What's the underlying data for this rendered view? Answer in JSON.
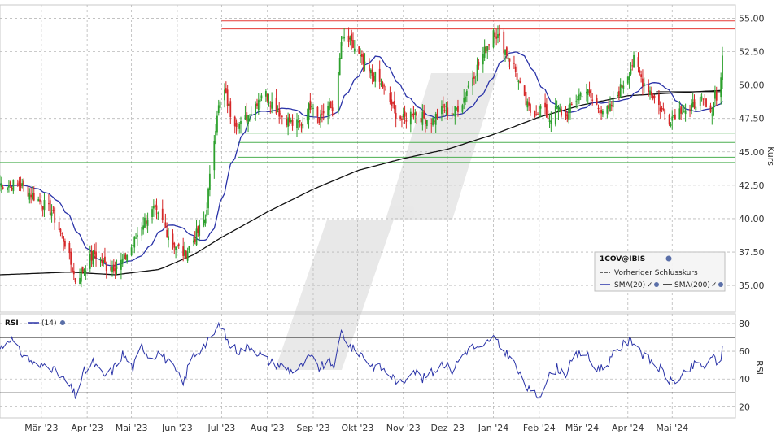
{
  "chart_data": [
    {
      "type": "candlestick",
      "ylabel": "Kurs",
      "ylim": [
        33.0,
        56.0
      ],
      "yticks": [
        "35.00",
        "37.50",
        "40.00",
        "42.50",
        "45.00",
        "47.50",
        "50.00",
        "52.50",
        "55.00"
      ],
      "xticks": [
        "Mär '23",
        "Apr '23",
        "Mai '23",
        "Jun '23",
        "Jul '23",
        "Aug '23",
        "Sep '23",
        "Okt '23",
        "Nov '23",
        "Dez '23",
        "Jan '24",
        "Feb '24",
        "Mär '24",
        "Apr '24",
        "Mai '24"
      ],
      "grid": true,
      "resistance_lines": [
        54.8,
        54.2
      ],
      "support_lines": [
        46.4,
        45.7,
        44.6,
        44.2
      ],
      "dashed_level": 49.5,
      "anchors": [
        [
          "2023-02-01",
          42.6
        ],
        [
          "2023-02-15",
          42.5
        ],
        [
          "2023-02-27",
          41.4
        ],
        [
          "2023-03-08",
          40.5
        ],
        [
          "2023-03-17",
          38.2
        ],
        [
          "2023-03-24",
          35.4
        ],
        [
          "2023-03-31",
          36.5
        ],
        [
          "2023-04-06",
          37.4
        ],
        [
          "2023-04-15",
          36.3
        ],
        [
          "2023-04-23",
          36.6
        ],
        [
          "2023-04-30",
          37.6
        ],
        [
          "2023-05-08",
          39.6
        ],
        [
          "2023-05-16",
          40.6
        ],
        [
          "2023-05-23",
          39.5
        ],
        [
          "2023-05-29",
          38.2
        ],
        [
          "2023-06-06",
          37.3
        ],
        [
          "2023-06-14",
          38.8
        ],
        [
          "2023-06-20",
          40.0
        ],
        [
          "2023-06-23",
          43.0
        ],
        [
          "2023-06-28",
          48.0
        ],
        [
          "2023-07-03",
          49.5
        ],
        [
          "2023-07-08",
          47.5
        ],
        [
          "2023-07-14",
          47.0
        ],
        [
          "2023-07-22",
          48.2
        ],
        [
          "2023-07-29",
          49.6
        ],
        [
          "2023-08-05",
          48.5
        ],
        [
          "2023-08-12",
          47.6
        ],
        [
          "2023-08-19",
          47.0
        ],
        [
          "2023-08-25",
          47.2
        ],
        [
          "2023-08-31",
          48.8
        ],
        [
          "2023-09-05",
          47.6
        ],
        [
          "2023-09-11",
          48.4
        ],
        [
          "2023-09-16",
          48.0
        ],
        [
          "2023-09-20",
          53.2
        ],
        [
          "2023-09-23",
          53.5
        ],
        [
          "2023-09-30",
          52.6
        ],
        [
          "2023-10-07",
          51.1
        ],
        [
          "2023-10-14",
          50.5
        ],
        [
          "2023-10-19",
          49.7
        ],
        [
          "2023-10-26",
          48.0
        ],
        [
          "2023-11-01",
          47.4
        ],
        [
          "2023-11-08",
          48.0
        ],
        [
          "2023-11-15",
          47.5
        ],
        [
          "2023-11-21",
          47.4
        ],
        [
          "2023-11-28",
          48.2
        ],
        [
          "2023-12-05",
          47.9
        ],
        [
          "2023-12-11",
          48.8
        ],
        [
          "2023-12-17",
          50.5
        ],
        [
          "2023-12-22",
          51.5
        ],
        [
          "2023-12-28",
          53.0
        ],
        [
          "2024-01-01",
          54.2
        ],
        [
          "2024-01-04",
          53.6
        ],
        [
          "2024-01-09",
          52.6
        ],
        [
          "2024-01-15",
          51.4
        ],
        [
          "2024-01-21",
          49.0
        ],
        [
          "2024-01-27",
          47.8
        ],
        [
          "2024-02-02",
          48.3
        ],
        [
          "2024-02-08",
          47.5
        ],
        [
          "2024-02-13",
          48.2
        ],
        [
          "2024-02-19",
          47.6
        ],
        [
          "2024-02-25",
          48.8
        ],
        [
          "2024-03-03",
          49.8
        ],
        [
          "2024-03-09",
          48.6
        ],
        [
          "2024-03-14",
          48.2
        ],
        [
          "2024-03-19",
          48.0
        ],
        [
          "2024-03-25",
          49.3
        ],
        [
          "2024-03-31",
          50.6
        ],
        [
          "2024-04-05",
          51.8
        ],
        [
          "2024-04-11",
          50.3
        ],
        [
          "2024-04-15",
          49.8
        ],
        [
          "2024-04-21",
          48.6
        ],
        [
          "2024-04-25",
          48.0
        ],
        [
          "2024-04-29",
          47.4
        ],
        [
          "2024-05-03",
          47.9
        ],
        [
          "2024-05-08",
          48.3
        ],
        [
          "2024-05-13",
          48.0
        ],
        [
          "2024-05-18",
          49.0
        ],
        [
          "2024-05-23",
          48.5
        ],
        [
          "2024-05-27",
          47.6
        ],
        [
          "2024-05-30",
          49.5
        ],
        [
          "2024-06-02",
          48.7
        ],
        [
          "2024-06-04",
          52.2
        ]
      ],
      "sma200_anchors": [
        [
          "2023-02-01",
          35.8
        ],
        [
          "2023-03-20",
          36.0
        ],
        [
          "2023-04-20",
          35.8
        ],
        [
          "2023-05-20",
          36.2
        ],
        [
          "2023-06-12",
          37.3
        ],
        [
          "2023-07-01",
          38.6
        ],
        [
          "2023-08-01",
          40.5
        ],
        [
          "2023-09-01",
          42.2
        ],
        [
          "2023-10-01",
          43.6
        ],
        [
          "2023-11-01",
          44.5
        ],
        [
          "2023-12-01",
          45.2
        ],
        [
          "2024-01-01",
          46.3
        ],
        [
          "2024-02-01",
          47.6
        ],
        [
          "2024-03-01",
          48.5
        ],
        [
          "2024-04-01",
          49.2
        ],
        [
          "2024-05-01",
          49.4
        ],
        [
          "2024-06-04",
          49.6
        ]
      ],
      "legend": {
        "placement": "bottom-right",
        "title": "1COV@IBIS",
        "items": [
          "Vorheriger Schlusskurs",
          "SMA(20)",
          "SMA(200)"
        ]
      },
      "colors": {
        "up": "#2ca02c",
        "down": "#d62728",
        "sma20": "#2a33a8",
        "sma200": "#111111",
        "resistance": "#e53935",
        "support": "#4caf50"
      }
    },
    {
      "type": "line",
      "ylabel": "RSI",
      "ylim": [
        12,
        87
      ],
      "yticks": [
        "20",
        "40",
        "60",
        "80"
      ],
      "levels": [
        30,
        70
      ],
      "legend": {
        "title": "RSI",
        "items": [
          "(14)"
        ]
      },
      "anchors": [
        [
          "2023-02-01",
          62
        ],
        [
          "2023-02-08",
          70
        ],
        [
          "2023-02-14",
          60
        ],
        [
          "2023-02-20",
          55
        ],
        [
          "2023-02-27",
          48
        ],
        [
          "2023-03-05",
          52
        ],
        [
          "2023-03-12",
          43
        ],
        [
          "2023-03-18",
          38
        ],
        [
          "2023-03-24",
          28
        ],
        [
          "2023-03-30",
          45
        ],
        [
          "2023-04-05",
          52
        ],
        [
          "2023-04-12",
          42
        ],
        [
          "2023-04-18",
          46
        ],
        [
          "2023-04-25",
          58
        ],
        [
          "2023-05-02",
          48
        ],
        [
          "2023-05-08",
          64
        ],
        [
          "2023-05-14",
          55
        ],
        [
          "2023-05-20",
          60
        ],
        [
          "2023-05-26",
          52
        ],
        [
          "2023-06-01",
          44
        ],
        [
          "2023-06-05",
          36
        ],
        [
          "2023-06-10",
          55
        ],
        [
          "2023-06-17",
          62
        ],
        [
          "2023-06-23",
          68
        ],
        [
          "2023-06-30",
          80
        ],
        [
          "2023-07-06",
          65
        ],
        [
          "2023-07-13",
          60
        ],
        [
          "2023-07-20",
          64
        ],
        [
          "2023-07-27",
          58
        ],
        [
          "2023-08-03",
          52
        ],
        [
          "2023-08-10",
          50
        ],
        [
          "2023-08-17",
          46
        ],
        [
          "2023-08-23",
          48
        ],
        [
          "2023-08-30",
          56
        ],
        [
          "2023-09-05",
          48
        ],
        [
          "2023-09-11",
          52
        ],
        [
          "2023-09-16",
          50
        ],
        [
          "2023-09-20",
          74
        ],
        [
          "2023-09-27",
          62
        ],
        [
          "2023-10-04",
          58
        ],
        [
          "2023-10-10",
          50
        ],
        [
          "2023-10-17",
          48
        ],
        [
          "2023-10-24",
          42
        ],
        [
          "2023-10-31",
          36
        ],
        [
          "2023-11-07",
          48
        ],
        [
          "2023-11-14",
          40
        ],
        [
          "2023-11-21",
          45
        ],
        [
          "2023-11-28",
          52
        ],
        [
          "2023-12-04",
          46
        ],
        [
          "2023-12-10",
          56
        ],
        [
          "2023-12-17",
          64
        ],
        [
          "2023-12-24",
          60
        ],
        [
          "2023-12-31",
          72
        ],
        [
          "2024-01-06",
          62
        ],
        [
          "2024-01-13",
          56
        ],
        [
          "2024-01-19",
          42
        ],
        [
          "2024-01-26",
          30
        ],
        [
          "2024-02-01",
          28
        ],
        [
          "2024-02-06",
          40
        ],
        [
          "2024-02-13",
          48
        ],
        [
          "2024-02-19",
          44
        ],
        [
          "2024-02-25",
          56
        ],
        [
          "2024-03-03",
          60
        ],
        [
          "2024-03-09",
          48
        ],
        [
          "2024-03-16",
          48
        ],
        [
          "2024-03-23",
          58
        ],
        [
          "2024-03-30",
          66
        ],
        [
          "2024-04-06",
          68
        ],
        [
          "2024-04-12",
          56
        ],
        [
          "2024-04-18",
          52
        ],
        [
          "2024-04-24",
          46
        ],
        [
          "2024-04-30",
          38
        ],
        [
          "2024-05-06",
          40
        ],
        [
          "2024-05-12",
          46
        ],
        [
          "2024-05-18",
          52
        ],
        [
          "2024-05-24",
          48
        ],
        [
          "2024-05-30",
          58
        ],
        [
          "2024-06-02",
          42
        ],
        [
          "2024-06-04",
          64
        ]
      ],
      "colors": {
        "line": "#2a33a8",
        "level": "#111111"
      }
    }
  ]
}
